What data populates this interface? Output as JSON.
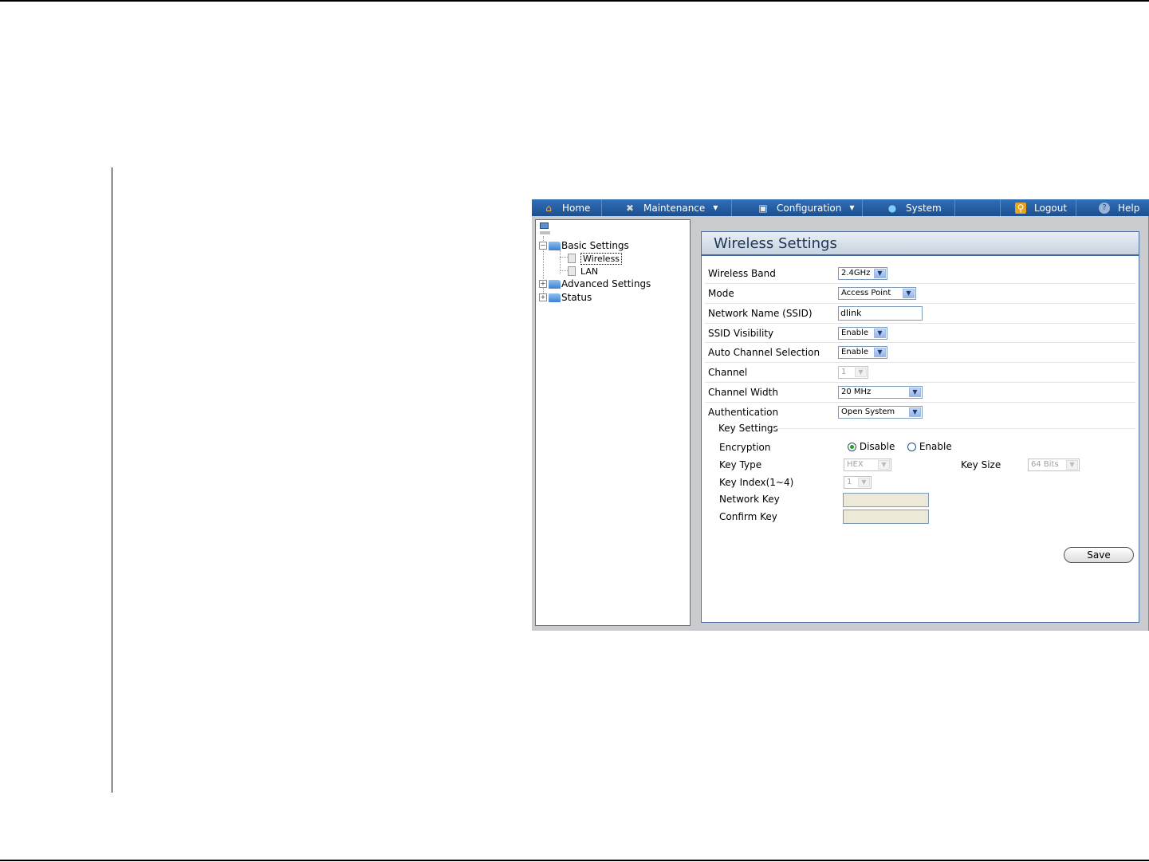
{
  "menu": {
    "home": "Home",
    "maintenance": "Maintenance",
    "configuration": "Configuration",
    "system": "System",
    "logout": "Logout",
    "help": "Help"
  },
  "tree": {
    "basic": "Basic Settings",
    "wireless": "Wireless",
    "lan": "LAN",
    "advanced": "Advanced Settings",
    "status": "Status"
  },
  "panel": {
    "title": "Wireless Settings",
    "fields": {
      "band_label": "Wireless Band",
      "band_value": "2.4GHz",
      "mode_label": "Mode",
      "mode_value": "Access Point",
      "ssid_label": "Network Name (SSID)",
      "ssid_value": "dlink",
      "visibility_label": "SSID Visibility",
      "visibility_value": "Enable",
      "auto_channel_label": "Auto Channel Selection",
      "auto_channel_value": "Enable",
      "channel_label": "Channel",
      "channel_value": "1",
      "width_label": "Channel Width",
      "width_value": "20 MHz",
      "auth_label": "Authentication",
      "auth_value": "Open System"
    },
    "key": {
      "section_label": "Key Settings",
      "encryption_label": "Encryption",
      "disable_label": "Disable",
      "enable_label": "Enable",
      "key_type_label": "Key Type",
      "key_type_value": "HEX",
      "key_size_label": "Key Size",
      "key_size_value": "64 Bits",
      "key_index_label": "Key Index(1~4)",
      "key_index_value": "1",
      "network_key_label": "Network Key",
      "network_key_value": "",
      "confirm_key_label": "Confirm Key",
      "confirm_key_value": ""
    },
    "save_label": "Save"
  },
  "colors": {
    "menubar": "#1d4f8e",
    "frame": "#c9cbce",
    "panel_border": "#4a6fa0"
  }
}
